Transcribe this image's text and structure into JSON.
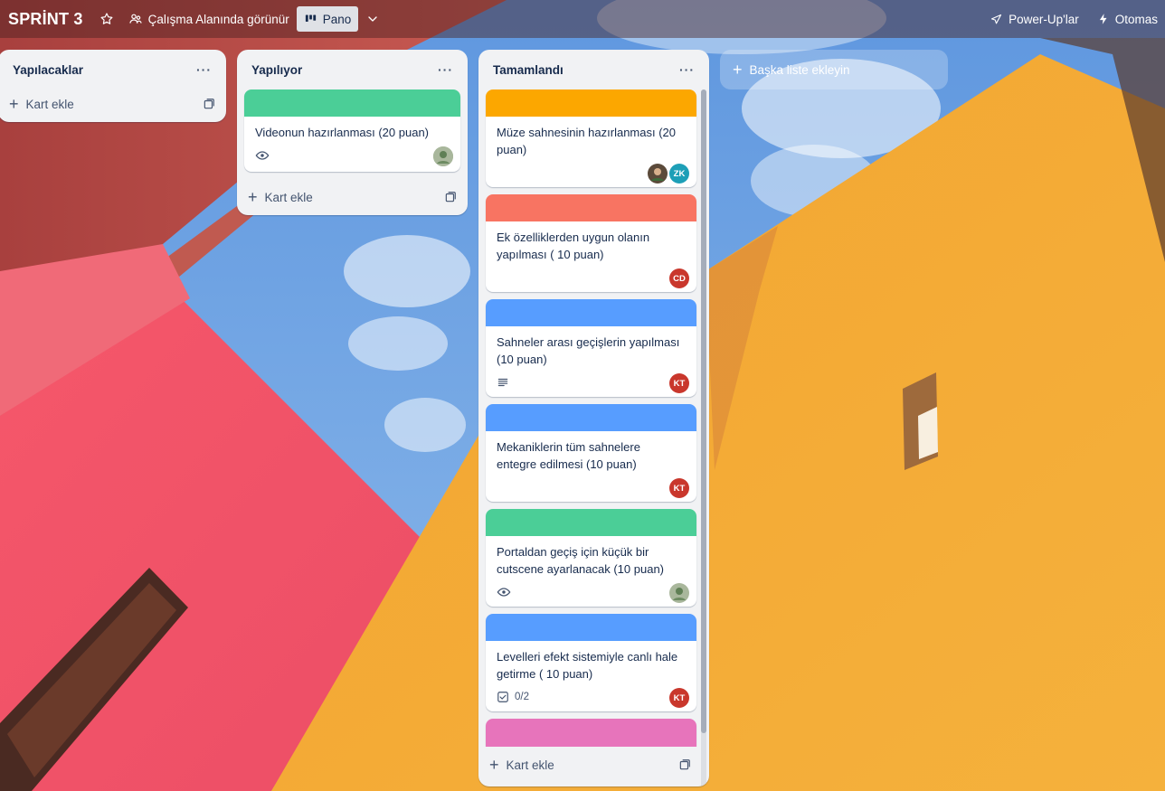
{
  "header": {
    "title": "SPRİNT 3",
    "visibility": "Çalışma Alanında görünür",
    "view": "Pano",
    "powerups": "Power-Up'lar",
    "automation": "Otomas"
  },
  "lists": [
    {
      "title": "Yapılacaklar",
      "add_card": "Kart ekle",
      "cards": []
    },
    {
      "title": "Yapılıyor",
      "add_card": "Kart ekle",
      "cards": [
        {
          "title": "Videonun hazırlanması (20 puan)",
          "cover": "#4bce97",
          "badge": "eye-icon"
        }
      ]
    },
    {
      "title": "Tamamlandı",
      "add_card": "Kart ekle",
      "cards": [
        {
          "title": "Müze sahnesinin hazırlanması (20 puan)",
          "cover": "#fca700",
          "members": [
            "ZK"
          ]
        },
        {
          "title": "Ek özelliklerden uygun olanın yapılması ( 10 puan)",
          "cover": "#f87462",
          "members": [
            "CD"
          ]
        },
        {
          "title": "Sahneler arası geçişlerin yapılması (10 puan)",
          "cover": "#579dff",
          "badge": "description-icon",
          "members": [
            "KT"
          ]
        },
        {
          "title": "Mekaniklerin tüm sahnelere entegre edilmesi (10 puan)",
          "cover": "#579dff",
          "members": [
            "KT"
          ]
        },
        {
          "title": "Portaldan geçiş için küçük bir cutscene ayarlanacak (10 puan)",
          "cover": "#4bce97",
          "badge": "eye-icon"
        },
        {
          "title": "Levelleri efekt sistemiyle canlı hale getirme ( 10 puan)",
          "cover": "#579dff",
          "checklist": "0/2",
          "members": [
            "KT"
          ]
        }
      ],
      "partial_card_cover": "#e774bb"
    }
  ],
  "add_list": "Başka liste ekleyin",
  "colors": {
    "avatar_red": "#c9372c",
    "avatar_teal": "#1d9fb7",
    "list_bg": "#f1f2f4"
  }
}
